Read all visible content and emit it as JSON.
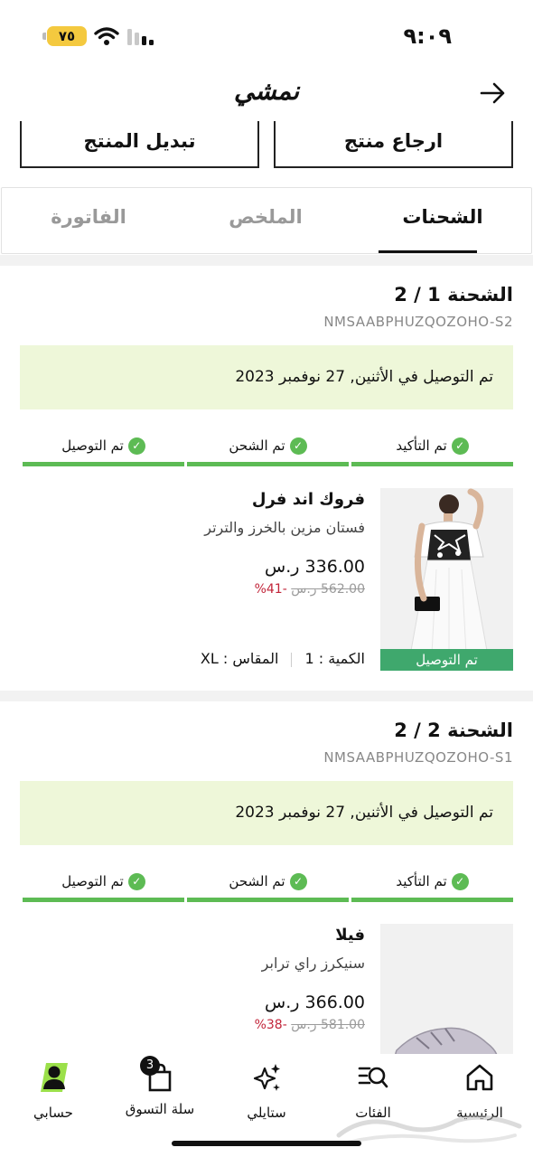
{
  "status_bar": {
    "time": "٩:٠٩",
    "battery": "٧٥"
  },
  "header": {
    "brand": "نمشي"
  },
  "actions": {
    "return_label": "ارجاع منتج",
    "exchange_label": "تبديل المنتج"
  },
  "tabs": [
    {
      "label": "الشحنات",
      "active": true
    },
    {
      "label": "الملخص",
      "active": false
    },
    {
      "label": "الفاتورة",
      "active": false
    }
  ],
  "shipments": [
    {
      "title": "الشحنة 1 / 2",
      "code": "NMSAABPHUZQOZOHO-S2",
      "delivered_message": "تم التوصيل في الأثنين, 27 نوفمبر 2023",
      "steps": [
        "تم التأكيد",
        "تم الشحن",
        "تم التوصيل"
      ],
      "product": {
        "brand": "فروك اند فرل",
        "description": "فستان مزين بالخرز والترتر",
        "price": "336.00",
        "old_price": "562.00",
        "discount": "-41%",
        "badge": "تم التوصيل",
        "qty_label": "الكمية : 1",
        "size_label": "المقاس : XL"
      }
    },
    {
      "title": "الشحنة 2 / 2",
      "code": "NMSAABPHUZQOZOHO-S1",
      "delivered_message": "تم التوصيل في الأثنين, 27 نوفمبر 2023",
      "steps": [
        "تم التأكيد",
        "تم الشحن",
        "تم التوصيل"
      ],
      "product": {
        "brand": "فيلا",
        "description": "سنيكرز راي ترابر",
        "price": "366.00",
        "old_price": "581.00",
        "discount": "-38%"
      }
    }
  ],
  "currency_symbol": "ر.س",
  "bottom_nav": [
    {
      "label": "الرئيسية",
      "icon": "home-icon"
    },
    {
      "label": "الفئات",
      "icon": "categories-search-icon"
    },
    {
      "label": "ستايلي",
      "icon": "sparkle-icon"
    },
    {
      "label": "سلة التسوق",
      "icon": "shopping-bag-icon",
      "badge": "3"
    },
    {
      "label": "حسابي",
      "icon": "account-icon"
    }
  ],
  "colors": {
    "green": "#5dbb54",
    "badge_green": "#3fa86d",
    "delivered_bg": "#eef7d9",
    "discount_red": "#c2253a",
    "battery_yellow": "#f4c93f"
  }
}
